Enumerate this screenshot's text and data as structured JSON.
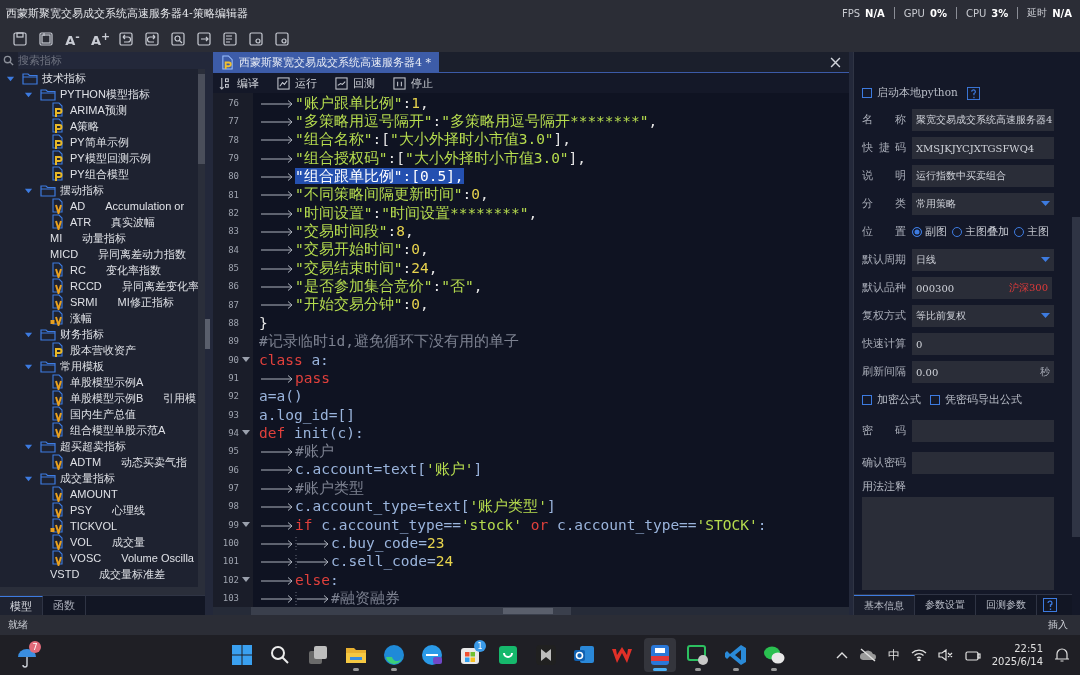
{
  "window": {
    "title": "西蒙斯聚宽交易成交系统高速服务器4-策略编辑器",
    "stats": [
      {
        "label": "FPS",
        "value": "N/A"
      },
      {
        "label": "GPU",
        "value": "0%"
      },
      {
        "label": "CPU",
        "value": "3%"
      },
      {
        "label": "延时",
        "value": "N/A"
      }
    ]
  },
  "toolbar": [
    {
      "kind": "save"
    },
    {
      "kind": "save-all"
    },
    {
      "kind": "text",
      "label": "A$^{-}$"
    },
    {
      "kind": "text",
      "label": "A$^{+}$"
    },
    {
      "kind": "undo"
    },
    {
      "kind": "redo"
    },
    {
      "kind": "find"
    },
    {
      "kind": "export"
    },
    {
      "kind": "import"
    },
    {
      "kind": "settings"
    },
    {
      "kind": "settings"
    }
  ],
  "search": {
    "placeholder": "搜索指标"
  },
  "tree": [
    {
      "label": "技术指标",
      "kind": "folder",
      "expanded": true,
      "children": [
        {
          "label": "PYTHON模型指标",
          "kind": "folder",
          "expanded": true,
          "children": [
            {
              "label": "ARIMA预测",
              "kind": "py"
            },
            {
              "label": "A策略",
              "kind": "py"
            },
            {
              "label": "PY简单示例",
              "kind": "py"
            },
            {
              "label": "PY模型回测示例",
              "kind": "py"
            },
            {
              "label": "PY组合模型",
              "kind": "py"
            }
          ]
        },
        {
          "label": "摆动指标",
          "kind": "folder",
          "expanded": true,
          "children": [
            {
              "label": "AD",
              "kind": "v",
              "desc": "Accumulation or"
            },
            {
              "label": "ATR",
              "kind": "v",
              "desc": "真实波幅"
            },
            {
              "label": "MI",
              "kind": "plain",
              "desc": "动量指标"
            },
            {
              "label": "MICD",
              "kind": "plain",
              "desc": "异同离差动力指数"
            },
            {
              "label": "RC",
              "kind": "v",
              "desc": "变化率指数"
            },
            {
              "label": "RCCD",
              "kind": "v",
              "desc": "异同离差变化率"
            },
            {
              "label": "SRMI",
              "kind": "v",
              "desc": "MI修正指标"
            },
            {
              "label": "涨幅",
              "kind": "locked-v"
            }
          ]
        },
        {
          "label": "财务指标",
          "kind": "folder",
          "expanded": true,
          "children": [
            {
              "label": "股本营收资产",
              "kind": "py"
            }
          ]
        },
        {
          "label": "常用模板",
          "kind": "folder",
          "expanded": true,
          "children": [
            {
              "label": "单股模型示例A",
              "kind": "v"
            },
            {
              "label": "单股模型示例B",
              "kind": "v",
              "desc": "引用模"
            },
            {
              "label": "国内生产总值",
              "kind": "v"
            },
            {
              "label": "组合模型单股示范A",
              "kind": "v"
            }
          ]
        },
        {
          "label": "超买超卖指标",
          "kind": "folder",
          "expanded": true,
          "children": [
            {
              "label": "ADTM",
              "kind": "v",
              "desc": "动态买卖气指"
            }
          ]
        },
        {
          "label": "成交量指标",
          "kind": "folder",
          "expanded": true,
          "children": [
            {
              "label": "AMOUNT",
              "kind": "v"
            },
            {
              "label": "PSY",
              "kind": "v",
              "desc": "心理线"
            },
            {
              "label": "TICKVOL",
              "kind": "locked-v"
            },
            {
              "label": "VOL",
              "kind": "v",
              "desc": "成交量"
            },
            {
              "label": "VOSC",
              "kind": "v",
              "desc": "Volume Oscilla"
            },
            {
              "label": "VSTD",
              "kind": "plain",
              "desc": "成交量标准差"
            }
          ]
        }
      ]
    }
  ],
  "left_tabs": [
    {
      "label": "模型",
      "selected": true
    },
    {
      "label": "函数",
      "selected": false
    }
  ],
  "editor": {
    "tab": {
      "label": "西蒙斯聚宽交易成交系统高速服务器4 *"
    },
    "actions": [
      {
        "label": "编译",
        "kind": "compile"
      },
      {
        "label": "运行",
        "kind": "run"
      },
      {
        "label": "回测",
        "kind": "backtest"
      },
      {
        "label": "停止",
        "kind": "stop"
      }
    ],
    "lines": [
      {
        "number": "76",
        "fold": false,
        "selected": false,
        "tokens": [
          {
            "kind": "tab"
          },
          {
            "kind": "str",
            "text": "\"账户跟单比例\""
          },
          {
            "kind": "punct",
            "text": ":"
          },
          {
            "kind": "num",
            "text": "1"
          },
          {
            "kind": "punct",
            "text": ","
          }
        ]
      },
      {
        "number": "77",
        "fold": false,
        "selected": false,
        "tokens": [
          {
            "kind": "tab"
          },
          {
            "kind": "str",
            "text": "\"多策略用逗号隔开\""
          },
          {
            "kind": "punct",
            "text": ":"
          },
          {
            "kind": "str",
            "text": "\"多策略用逗号隔开********\""
          },
          {
            "kind": "punct",
            "text": ","
          }
        ]
      },
      {
        "number": "78",
        "fold": false,
        "selected": false,
        "tokens": [
          {
            "kind": "tab"
          },
          {
            "kind": "str",
            "text": "\"组合名称\""
          },
          {
            "kind": "punct",
            "text": ":["
          },
          {
            "kind": "str",
            "text": "\"大小外择时小市值3.0\""
          },
          {
            "kind": "punct",
            "text": "],"
          }
        ]
      },
      {
        "number": "79",
        "fold": false,
        "selected": false,
        "tokens": [
          {
            "kind": "tab"
          },
          {
            "kind": "str",
            "text": "\"组合授权码\""
          },
          {
            "kind": "punct",
            "text": ":["
          },
          {
            "kind": "str",
            "text": "\"大小外择时小市值3.0\""
          },
          {
            "kind": "punct",
            "text": "],"
          }
        ]
      },
      {
        "number": "80",
        "fold": false,
        "selected": true,
        "tokens": [
          {
            "kind": "tab"
          },
          {
            "kind": "str",
            "text": "\"组合跟单比例\""
          },
          {
            "kind": "punct",
            "text": ":["
          },
          {
            "kind": "num",
            "text": "0.5"
          },
          {
            "kind": "punct",
            "text": "],"
          }
        ]
      },
      {
        "number": "81",
        "fold": false,
        "selected": false,
        "tokens": [
          {
            "kind": "tab"
          },
          {
            "kind": "str",
            "text": "\"不同策略间隔更新时间\""
          },
          {
            "kind": "punct",
            "text": ":"
          },
          {
            "kind": "num",
            "text": "0"
          },
          {
            "kind": "punct",
            "text": ","
          }
        ]
      },
      {
        "number": "82",
        "fold": false,
        "selected": false,
        "tokens": [
          {
            "kind": "tab"
          },
          {
            "kind": "str",
            "text": "\"时间设置\""
          },
          {
            "kind": "punct",
            "text": ":"
          },
          {
            "kind": "str",
            "text": "\"时间设置********\""
          },
          {
            "kind": "punct",
            "text": ","
          }
        ]
      },
      {
        "number": "83",
        "fold": false,
        "selected": false,
        "tokens": [
          {
            "kind": "tab"
          },
          {
            "kind": "str",
            "text": "\"交易时间段\""
          },
          {
            "kind": "punct",
            "text": ":"
          },
          {
            "kind": "num",
            "text": "8"
          },
          {
            "kind": "punct",
            "text": ","
          }
        ]
      },
      {
        "number": "84",
        "fold": false,
        "selected": false,
        "tokens": [
          {
            "kind": "tab"
          },
          {
            "kind": "str",
            "text": "\"交易开始时间\""
          },
          {
            "kind": "punct",
            "text": ":"
          },
          {
            "kind": "num",
            "text": "0"
          },
          {
            "kind": "punct",
            "text": ","
          }
        ]
      },
      {
        "number": "85",
        "fold": false,
        "selected": false,
        "tokens": [
          {
            "kind": "tab"
          },
          {
            "kind": "str",
            "text": "\"交易结束时间\""
          },
          {
            "kind": "punct",
            "text": ":"
          },
          {
            "kind": "num",
            "text": "24"
          },
          {
            "kind": "punct",
            "text": ","
          }
        ]
      },
      {
        "number": "86",
        "fold": false,
        "selected": false,
        "tokens": [
          {
            "kind": "tab"
          },
          {
            "kind": "str",
            "text": "\"是否参加集合竞价\""
          },
          {
            "kind": "punct",
            "text": ":"
          },
          {
            "kind": "str",
            "text": "\"否\""
          },
          {
            "kind": "punct",
            "text": ","
          }
        ]
      },
      {
        "number": "87",
        "fold": false,
        "selected": false,
        "tokens": [
          {
            "kind": "tab"
          },
          {
            "kind": "str",
            "text": "\"开始交易分钟\""
          },
          {
            "kind": "punct",
            "text": ":"
          },
          {
            "kind": "num",
            "text": "0"
          },
          {
            "kind": "punct",
            "text": ","
          }
        ]
      },
      {
        "number": "88",
        "fold": false,
        "selected": false,
        "tokens": [
          {
            "kind": "punct",
            "text": "}"
          }
        ]
      },
      {
        "number": "89",
        "fold": false,
        "selected": false,
        "tokens": [
          {
            "kind": "comment",
            "text": "#记录临时id,避免循环下没有用的单子"
          }
        ]
      },
      {
        "number": "90",
        "fold": true,
        "selected": false,
        "tokens": [
          {
            "kind": "kw",
            "text": "class"
          },
          {
            "kind": "ident",
            "text": " a:"
          }
        ]
      },
      {
        "number": "91",
        "fold": false,
        "selected": false,
        "tokens": [
          {
            "kind": "tab"
          },
          {
            "kind": "kw",
            "text": "pass"
          }
        ]
      },
      {
        "number": "92",
        "fold": false,
        "selected": false,
        "tokens": [
          {
            "kind": "ident",
            "text": "a=a()"
          }
        ]
      },
      {
        "number": "93",
        "fold": false,
        "selected": false,
        "tokens": [
          {
            "kind": "ident",
            "text": "a.log_id=[]"
          }
        ]
      },
      {
        "number": "94",
        "fold": true,
        "selected": false,
        "tokens": [
          {
            "kind": "kw",
            "text": "def"
          },
          {
            "kind": "ident",
            "text": " init(c):"
          }
        ]
      },
      {
        "number": "95",
        "fold": false,
        "selected": false,
        "tokens": [
          {
            "kind": "tab"
          },
          {
            "kind": "comment",
            "text": "#账户"
          }
        ]
      },
      {
        "number": "96",
        "fold": false,
        "selected": false,
        "tokens": [
          {
            "kind": "tab"
          },
          {
            "kind": "ident",
            "text": "c.account=text["
          },
          {
            "kind": "str",
            "text": "'账户'"
          },
          {
            "kind": "ident",
            "text": "]"
          }
        ]
      },
      {
        "number": "97",
        "fold": false,
        "selected": false,
        "tokens": [
          {
            "kind": "tab"
          },
          {
            "kind": "comment",
            "text": "#账户类型"
          }
        ]
      },
      {
        "number": "98",
        "fold": false,
        "selected": false,
        "tokens": [
          {
            "kind": "tab"
          },
          {
            "kind": "ident",
            "text": "c.account_type=text["
          },
          {
            "kind": "str",
            "text": "'账户类型'"
          },
          {
            "kind": "ident",
            "text": "]"
          }
        ]
      },
      {
        "number": "99",
        "fold": true,
        "selected": false,
        "tokens": [
          {
            "kind": "tab"
          },
          {
            "kind": "kw",
            "text": "if"
          },
          {
            "kind": "ident",
            "text": " c.account_type=="
          },
          {
            "kind": "str",
            "text": "'stock'"
          },
          {
            "kind": "kw",
            "text": " or "
          },
          {
            "kind": "ident",
            "text": "c.account_type=="
          },
          {
            "kind": "str",
            "text": "'STOCK'"
          },
          {
            "kind": "ident",
            "text": ":"
          }
        ]
      },
      {
        "number": "100",
        "fold": false,
        "selected": false,
        "tokens": [
          {
            "kind": "tab"
          },
          {
            "kind": "tab"
          },
          {
            "kind": "ident",
            "text": "c.buy_code="
          },
          {
            "kind": "num",
            "text": "23"
          }
        ]
      },
      {
        "number": "101",
        "fold": false,
        "selected": false,
        "tokens": [
          {
            "kind": "tab"
          },
          {
            "kind": "tab"
          },
          {
            "kind": "ident",
            "text": "c.sell_code="
          },
          {
            "kind": "num",
            "text": "24"
          }
        ]
      },
      {
        "number": "102",
        "fold": true,
        "selected": false,
        "tokens": [
          {
            "kind": "tab"
          },
          {
            "kind": "kw",
            "text": "else"
          },
          {
            "kind": "ident",
            "text": ":"
          }
        ]
      },
      {
        "number": "103",
        "fold": false,
        "selected": false,
        "tokens": [
          {
            "kind": "tab"
          },
          {
            "kind": "tab"
          },
          {
            "kind": "comment",
            "text": "#融资融券"
          }
        ]
      }
    ]
  },
  "properties": {
    "local_python": {
      "label": "启动本地python",
      "checked": false
    },
    "fields": [
      {
        "kind": "text",
        "label": "名称",
        "value": "聚宽交易成交系统高速服务器4"
      },
      {
        "kind": "text",
        "label": "快捷码",
        "value": "XMSJKJYCJXTGSFWQ4"
      },
      {
        "kind": "text",
        "label": "说明",
        "value": "运行指数中买卖组合"
      },
      {
        "kind": "select",
        "label": "分类",
        "value": "常用策略"
      },
      {
        "kind": "radio",
        "label": "位置",
        "options": [
          {
            "label": "副图",
            "selected": true
          },
          {
            "label": "主图叠加",
            "selected": false
          },
          {
            "label": "主图",
            "selected": false
          }
        ]
      },
      {
        "kind": "select",
        "label": "默认周期",
        "value": "日线"
      },
      {
        "kind": "symbol",
        "label": "默认品种",
        "value": "000300",
        "note": "沪深300"
      },
      {
        "kind": "select",
        "label": "复权方式",
        "value": "等比前复权"
      },
      {
        "kind": "text",
        "label": "快速计算",
        "value": "0"
      },
      {
        "kind": "unit",
        "label": "刷新间隔",
        "value": "0.00",
        "unit": "秒"
      },
      {
        "kind": "checks",
        "options": [
          {
            "label": "加密公式",
            "checked": false
          },
          {
            "label": "凭密码导出公式",
            "checked": false
          }
        ]
      },
      {
        "kind": "password",
        "label": "密码"
      },
      {
        "kind": "password",
        "label": "确认密码"
      },
      {
        "kind": "notes",
        "label": "用法注释"
      }
    ],
    "tabs": [
      {
        "label": "基本信息",
        "selected": true
      },
      {
        "label": "参数设置",
        "selected": false
      },
      {
        "label": "回测参数",
        "selected": false
      }
    ]
  },
  "status_bar": {
    "left": "就绪",
    "right": "插入"
  },
  "taskbar": {
    "weather_badge": "7",
    "apps": [
      {
        "kind": "start",
        "running": false,
        "selected": false
      },
      {
        "kind": "search",
        "running": false,
        "selected": false
      },
      {
        "kind": "taskview",
        "running": false,
        "selected": false
      },
      {
        "kind": "files",
        "running": true,
        "selected": false
      },
      {
        "kind": "browser",
        "running": true,
        "selected": false
      },
      {
        "kind": "ai-browser",
        "running": false,
        "selected": false
      },
      {
        "kind": "store",
        "running": false,
        "selected": false,
        "badge": "1"
      },
      {
        "kind": "bag",
        "running": false,
        "selected": false
      },
      {
        "kind": "game",
        "running": false,
        "selected": false
      },
      {
        "kind": "mail",
        "running": false,
        "selected": false
      },
      {
        "kind": "office",
        "running": false,
        "selected": false
      },
      {
        "kind": "trading",
        "running": true,
        "selected": true
      },
      {
        "kind": "screen-chat",
        "running": true,
        "selected": false
      },
      {
        "kind": "code",
        "running": true,
        "selected": false
      },
      {
        "kind": "chat",
        "running": true,
        "selected": false
      }
    ],
    "ime": "中",
    "time": "22:51",
    "date": "2025/6/14"
  }
}
